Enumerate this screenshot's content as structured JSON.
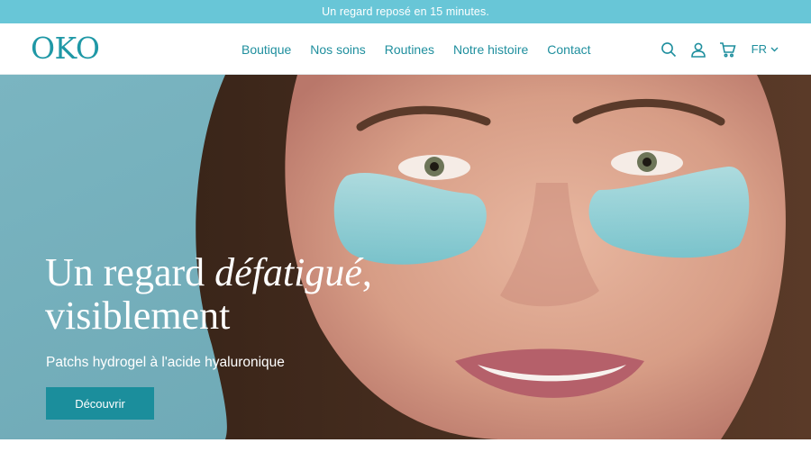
{
  "announcement": "Un regard reposé en 15 minutes.",
  "brand": "OKO",
  "nav": [
    {
      "label": "Boutique"
    },
    {
      "label": "Nos soins"
    },
    {
      "label": "Routines"
    },
    {
      "label": "Notre histoire"
    },
    {
      "label": "Contact"
    }
  ],
  "tools": {
    "icons": [
      "search-icon",
      "user-icon",
      "cart-icon"
    ],
    "language": "FR"
  },
  "hero": {
    "title_part1": "Un regard ",
    "title_emphasis": "défatigué",
    "title_part2": ",",
    "title_line2": "visiblement",
    "subtitle": "Patchs hydrogel à l'acide hyaluronique",
    "cta_label": "Découvrir"
  },
  "colors": {
    "accent": "#1b8e9c",
    "announcement_bg": "#68c6d7"
  }
}
